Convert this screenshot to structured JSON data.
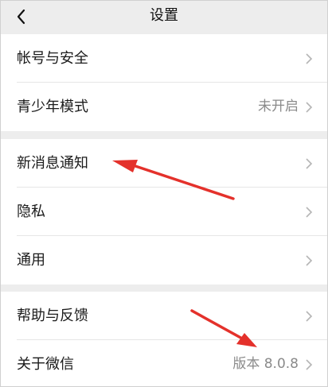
{
  "header": {
    "title": "设置"
  },
  "groups": [
    {
      "items": [
        {
          "label": "帐号与安全",
          "value": ""
        },
        {
          "label": "青少年模式",
          "value": "未开启"
        }
      ]
    },
    {
      "items": [
        {
          "label": "新消息通知",
          "value": ""
        },
        {
          "label": "隐私",
          "value": ""
        },
        {
          "label": "通用",
          "value": ""
        }
      ]
    },
    {
      "items": [
        {
          "label": "帮助与反馈",
          "value": ""
        },
        {
          "label": "关于微信",
          "value": "版本 8.0.8"
        }
      ]
    }
  ],
  "icons": {
    "back": "chevron-left-icon",
    "row": "chevron-right-icon",
    "annotation": "red-arrow"
  },
  "colors": {
    "background": "#ededed",
    "annotation_arrow": "#e4312b"
  }
}
